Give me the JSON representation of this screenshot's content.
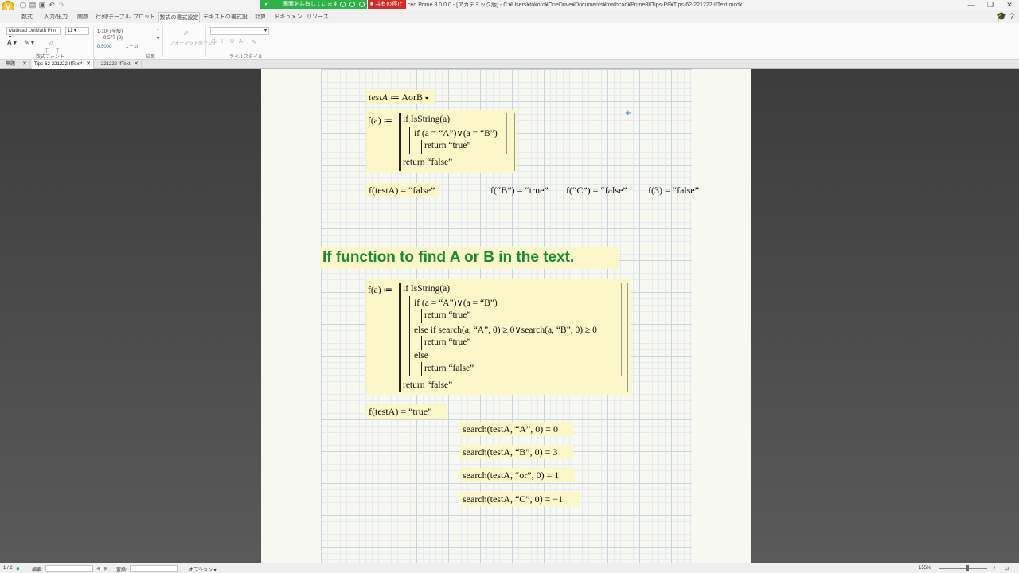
{
  "app": {
    "logo_letter": "M",
    "title": "ced Prime 8.0.0.0 - [アカデミック版] - C:¥Users¥tokoro¥OneDrive¥Documents¥mathcad¥Prime8¥Tips-P8¥Tips-62-221222-IfText.mcdx"
  },
  "share": {
    "sharing_label": "画面を共有しています",
    "stop_label": "共有の停止"
  },
  "menu_tabs": [
    "数式",
    "入力/出力",
    "関数",
    "行列/テーブル",
    "プロット",
    "数式の書式設定",
    "テキストの書式設定",
    "計算",
    "ドキュメント",
    "リソース"
  ],
  "active_tab": "数式の書式設定",
  "ribbon": {
    "font_name": "Mathcad UniMath Prin",
    "font_size": "11",
    "fmt_line1": "1·10⁶ (全般)",
    "fmt_line2": "0.577 (3)",
    "fmt_line3a": "0.5000",
    "fmt_line3b": "1 + 1i",
    "format_painter": "フォーマットのクリア",
    "group_font": "数式フォント",
    "group_result": "結果",
    "group_label_style": "ラベルスタイル"
  },
  "doc_tabs": [
    {
      "label": "無題",
      "active": false
    },
    {
      "label": "Tips-62-221222-IfText*",
      "active": true
    },
    {
      "label": "221222-IfText",
      "active": false
    }
  ],
  "worksheet": {
    "def_testA": {
      "lhs": "testA",
      "op": " ≔ ",
      "rhs": "AorB",
      "dropdown": "▾"
    },
    "func1": {
      "head": "f(a) ≔",
      "lines": [
        "if IsString(a)",
        "if (a = “A”)∨(a = “B”)",
        "return “true”",
        "return “false”"
      ]
    },
    "eval1": "f(testA) = “false”",
    "evals_row": [
      "f(“B”) = “true”",
      "f(“C”) = “false”",
      "f(3) = “false”"
    ],
    "heading": "If function to find A or B in the text.",
    "func2": {
      "head": "f(a) ≔",
      "lines": [
        "if IsString(a)",
        "if (a = “A”)∨(a = “B”)",
        "return “true”",
        "else if search(a, “A”, 0) ≥ 0∨search(a, “B”, 0) ≥ 0",
        "return “true”",
        "else",
        "return “false”",
        "return “false”"
      ]
    },
    "eval2": "f(testA) = “true”",
    "search_results": [
      "search(testA, “A”, 0) = 0",
      "search(testA, “B”, 0) = 3",
      "search(testA, “or”, 0) = 1",
      "search(testA, “C”, 0) = −1"
    ]
  },
  "status": {
    "page": "1 / 2",
    "search_label": "検索:",
    "replace_label": "置換:",
    "options_label": "オプション",
    "zoom": "155%"
  },
  "colors": {
    "region_bg": "#fcf7c8",
    "heading_color": "#1a8a3a",
    "share_green": "#2db34a",
    "share_red": "#d62b2b"
  }
}
